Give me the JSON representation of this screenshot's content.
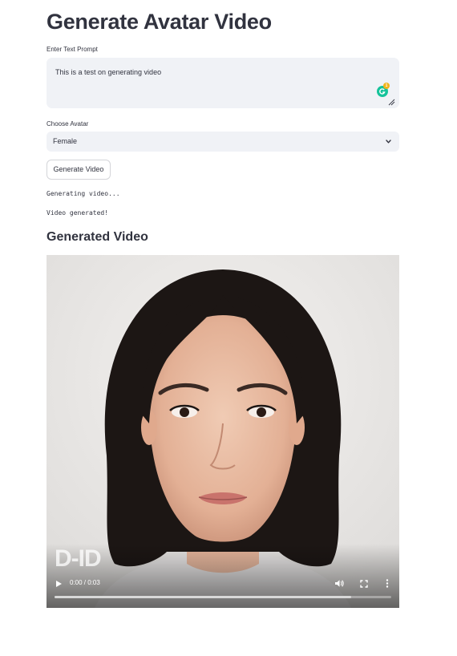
{
  "page": {
    "title": "Generate Avatar Video"
  },
  "prompt": {
    "label": "Enter Text Prompt",
    "value": "This is a test on generating video",
    "grammarly_badge": "1"
  },
  "avatar": {
    "label": "Choose Avatar",
    "selected": "Female"
  },
  "generate_button": {
    "label": "Generate Video"
  },
  "status": {
    "line1": "Generating video...",
    "line2": "Video generated!"
  },
  "video_section": {
    "heading": "Generated Video",
    "watermark": "D-ID",
    "time": "0:00 / 0:03",
    "progress_fraction": 0.88
  },
  "colors": {
    "input_background": "#f0f2f6",
    "text": "#31333f",
    "grammarly": "#15c39a"
  }
}
